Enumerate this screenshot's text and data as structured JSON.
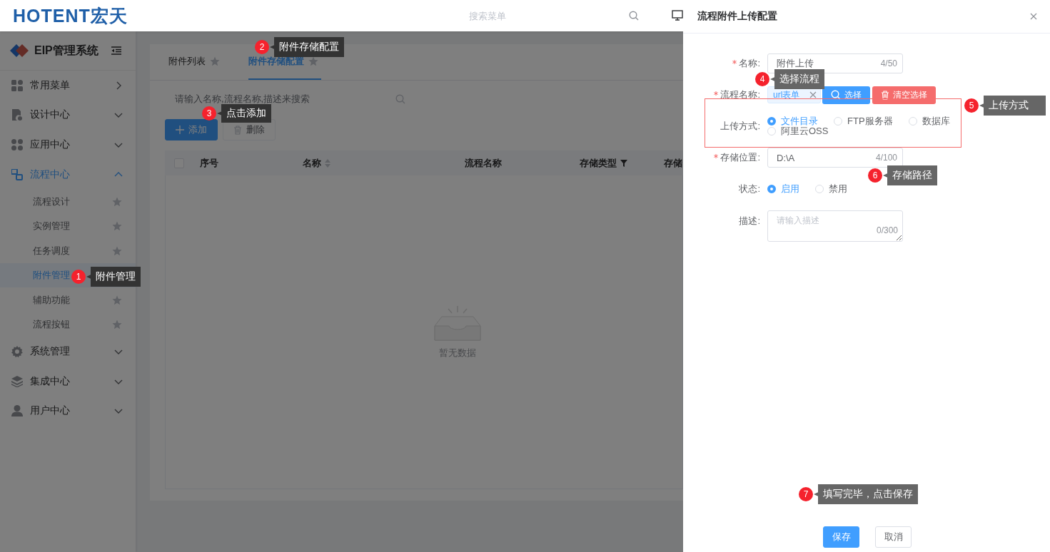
{
  "header": {
    "logo": "HOTENT宏天",
    "search": {
      "placeholder": "搜索菜单"
    }
  },
  "sidebar": {
    "title": "EIP管理系统",
    "items": [
      {
        "label": "常用菜单",
        "kind": "link"
      },
      {
        "label": "设计中心",
        "kind": "group",
        "expanded": false
      },
      {
        "label": "应用中心",
        "kind": "group",
        "expanded": false
      },
      {
        "label": "流程中心",
        "kind": "group",
        "expanded": true,
        "children": [
          {
            "label": "流程设计",
            "selected": false
          },
          {
            "label": "实例管理",
            "selected": false
          },
          {
            "label": "任务调度",
            "selected": false
          },
          {
            "label": "附件管理",
            "selected": true
          },
          {
            "label": "辅助功能",
            "selected": false
          },
          {
            "label": "流程按钮",
            "selected": false
          }
        ]
      },
      {
        "label": "系统管理",
        "kind": "group",
        "expanded": false
      },
      {
        "label": "集成中心",
        "kind": "group",
        "expanded": false
      },
      {
        "label": "用户中心",
        "kind": "group",
        "expanded": false
      }
    ]
  },
  "tabs": [
    {
      "label": "附件列表",
      "selected": false
    },
    {
      "label": "附件存储配置",
      "selected": true
    }
  ],
  "search": {
    "placeholder": "请输入名称,流程名称,描述来搜索"
  },
  "toolbar": [
    {
      "label": "添加",
      "kind": "primary"
    },
    {
      "label": "删除",
      "kind": "disabled"
    }
  ],
  "table": {
    "select_all": {
      "checked": false
    },
    "columns": [
      {
        "label": "序号",
        "kind": "plain"
      },
      {
        "label": "名称",
        "kind": "sortable"
      },
      {
        "label": "流程名称",
        "kind": "plain"
      },
      {
        "label": "存储类型",
        "kind": "filter"
      },
      {
        "label": "存储",
        "kind": "plain"
      }
    ],
    "empty_text": "暂无数据"
  },
  "drawer": {
    "title": "流程附件上传配置",
    "fields": [
      {
        "kind": "text",
        "label": "名称:",
        "required": true,
        "highlighted": false,
        "value": "附件上传",
        "counter": "4/50"
      },
      {
        "kind": "tags",
        "label": "流程名称:",
        "required": true,
        "highlighted": false,
        "tags": [
          "url表单"
        ],
        "buttons": [
          {
            "label": "选择",
            "kind": "primary"
          },
          {
            "label": "清空选择",
            "kind": "danger"
          }
        ]
      },
      {
        "kind": "radio",
        "label": "上传方式:",
        "required": false,
        "highlighted": true,
        "options": [
          {
            "label": "文件目录",
            "selected": true
          },
          {
            "label": "FTP服务器",
            "selected": false
          },
          {
            "label": "数据库",
            "selected": false
          },
          {
            "label": "阿里云OSS",
            "selected": false
          }
        ]
      },
      {
        "kind": "text",
        "label": "存储位置:",
        "required": true,
        "highlighted": false,
        "value": "D:\\A",
        "counter": "4/100"
      },
      {
        "kind": "radio",
        "label": "状态:",
        "required": false,
        "highlighted": false,
        "options": [
          {
            "label": "启用",
            "selected": true
          },
          {
            "label": "禁用",
            "selected": false
          }
        ]
      },
      {
        "kind": "textarea",
        "label": "描述:",
        "required": false,
        "highlighted": false,
        "placeholder": "请输入描述",
        "counter": "0/300"
      }
    ],
    "buttons": [
      {
        "label": "保存",
        "kind": "primary"
      },
      {
        "label": "取消",
        "kind": "default"
      }
    ]
  },
  "callouts": [
    {
      "number": "1",
      "text": "附件管理"
    },
    {
      "number": "2",
      "text": "附件存储配置"
    },
    {
      "number": "3",
      "text": "点击添加"
    },
    {
      "number": "4",
      "text": "选择流程"
    },
    {
      "number": "5",
      "text": "上传方式"
    },
    {
      "number": "6",
      "text": "存储路径"
    },
    {
      "number": "7",
      "text": "填写完毕，点击保存"
    }
  ]
}
